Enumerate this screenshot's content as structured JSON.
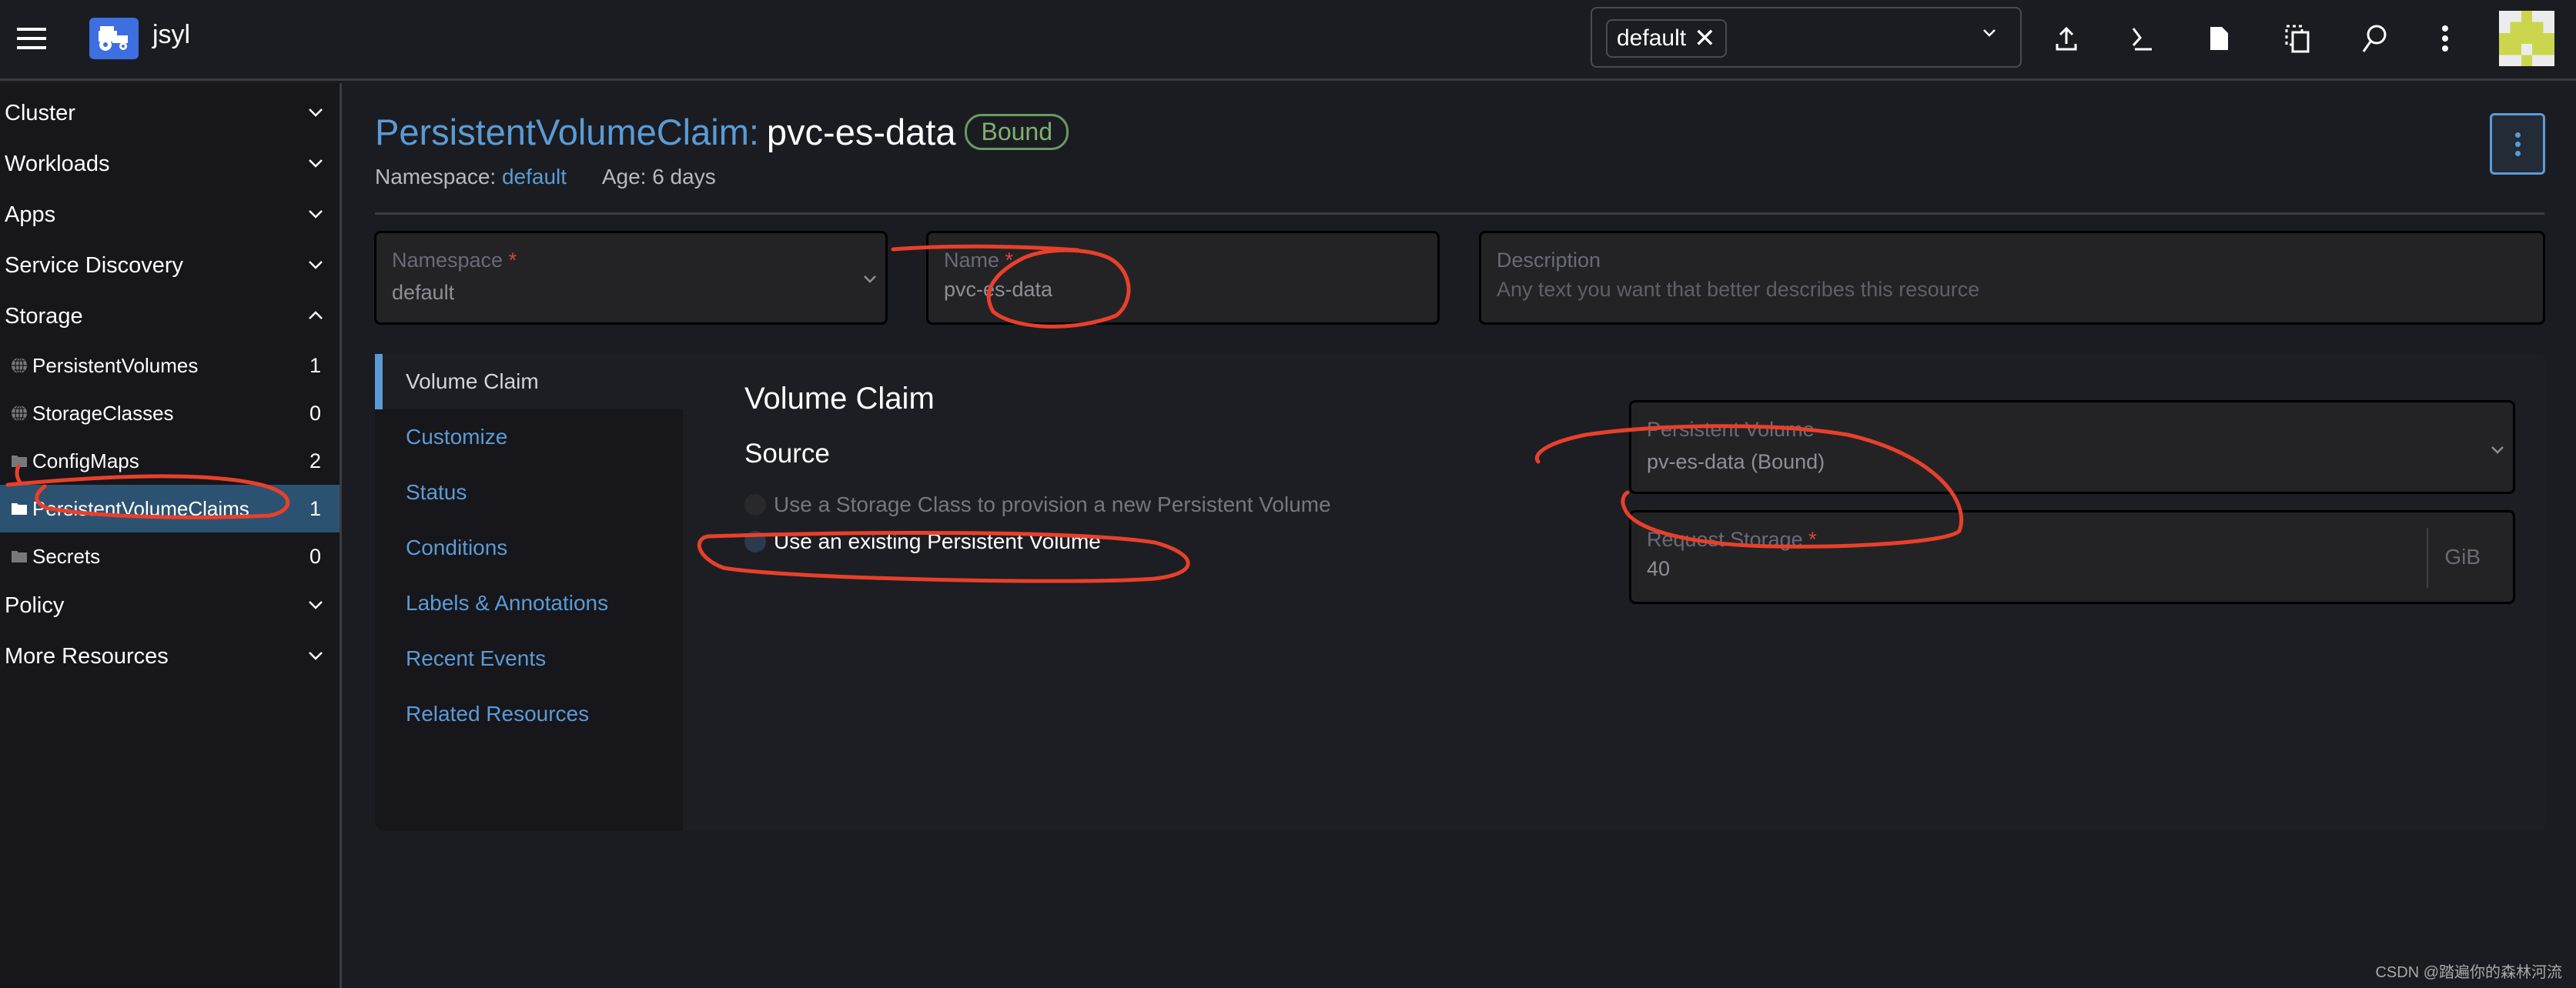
{
  "topbar": {
    "cluster_name": "jsyl",
    "namespace_filter": {
      "chip": "default"
    },
    "icons": [
      "import-yaml-icon",
      "kubectl-shell-icon",
      "kubeconfig-file-icon",
      "copy-kubeconfig-icon",
      "search-icon",
      "more-actions-icon"
    ]
  },
  "sidebar": {
    "groups": [
      {
        "label": "Cluster",
        "expanded": false
      },
      {
        "label": "Workloads",
        "expanded": false
      },
      {
        "label": "Apps",
        "expanded": false
      },
      {
        "label": "Service Discovery",
        "expanded": false
      },
      {
        "label": "Storage",
        "expanded": true
      }
    ],
    "storage_items": [
      {
        "label": "PersistentVolumes",
        "count": "1",
        "icon": "globe-icon"
      },
      {
        "label": "StorageClasses",
        "count": "0",
        "icon": "globe-icon"
      },
      {
        "label": "ConfigMaps",
        "count": "2",
        "icon": "folder-icon"
      },
      {
        "label": "PersistentVolumeClaims",
        "count": "1",
        "icon": "folder-icon",
        "active": true
      },
      {
        "label": "Secrets",
        "count": "0",
        "icon": "folder-icon"
      }
    ],
    "groups_after": [
      {
        "label": "Policy",
        "expanded": false
      },
      {
        "label": "More Resources",
        "expanded": false
      }
    ]
  },
  "header": {
    "kind": "PersistentVolumeClaim:",
    "name": "pvc-es-data",
    "status": "Bound",
    "namespace_label": "Namespace:",
    "namespace": "default",
    "age": "Age: 6 days"
  },
  "form": {
    "namespace": {
      "label": "Namespace",
      "required": "*",
      "value": "default"
    },
    "name": {
      "label": "Name",
      "required": "*",
      "value": "pvc-es-data"
    },
    "description": {
      "label": "Description",
      "placeholder": "Any text you want that better describes this resource"
    }
  },
  "tabs": [
    {
      "label": "Volume Claim",
      "active": true
    },
    {
      "label": "Customize"
    },
    {
      "label": "Status"
    },
    {
      "label": "Conditions"
    },
    {
      "label": "Labels & Annotations"
    },
    {
      "label": "Recent Events"
    },
    {
      "label": "Related Resources"
    }
  ],
  "volume_claim": {
    "title": "Volume Claim",
    "source_title": "Source",
    "options": [
      {
        "label": "Use a Storage Class to provision a new Persistent Volume",
        "disabled": true
      },
      {
        "label": "Use an existing Persistent Volume",
        "selected": true
      }
    ],
    "persistent_volume": {
      "label": "Persistent Volume",
      "value": "pv-es-data (Bound)"
    },
    "request_storage": {
      "label": "Request Storage",
      "required": "*",
      "value": "40",
      "unit": "GiB"
    }
  },
  "colors": {
    "accent": "#5b9bd5",
    "status_ok": "#7fb06f",
    "required": "#e0433a",
    "annotation": "#e8402a"
  },
  "watermark": "CSDN @踏遍你的森林河流"
}
